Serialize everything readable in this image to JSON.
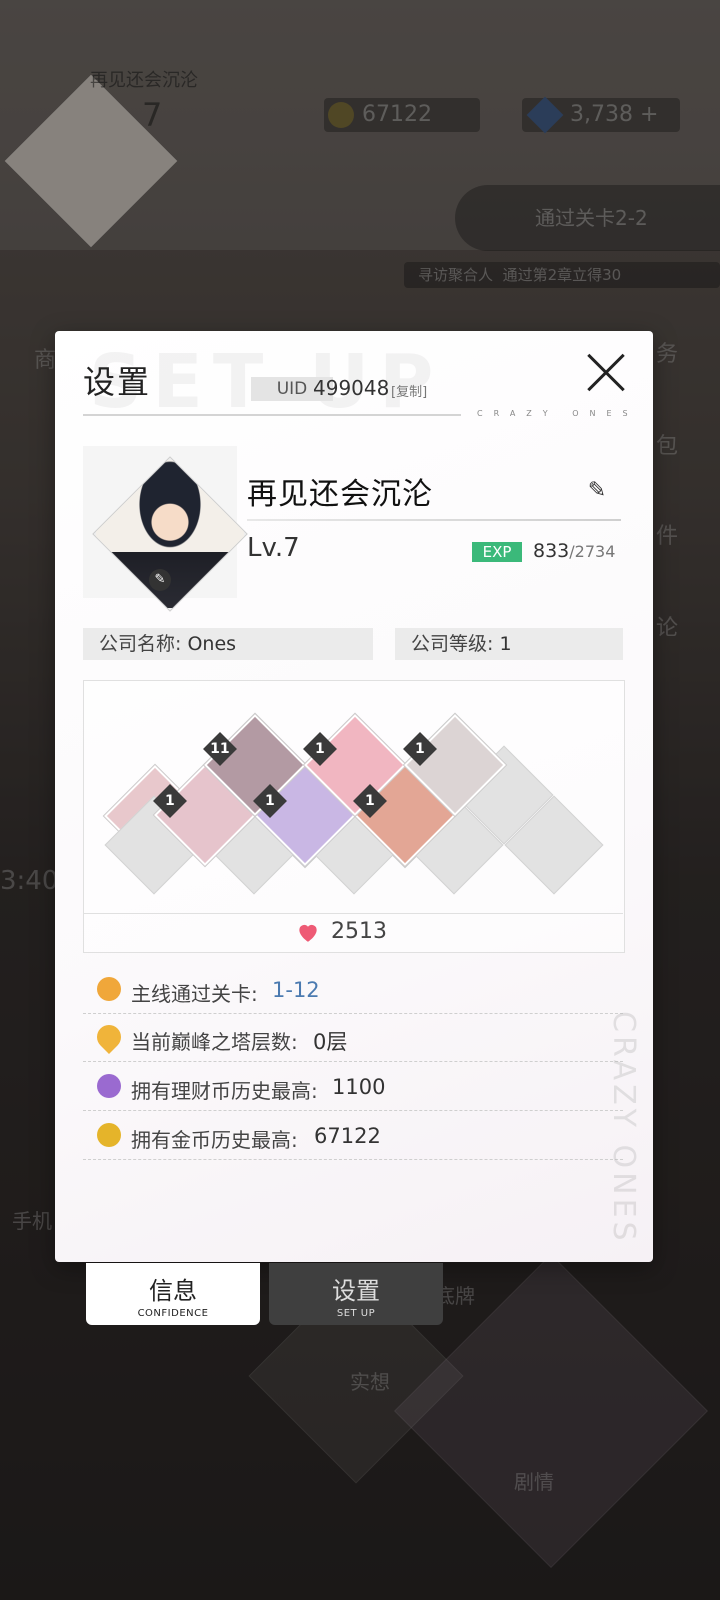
{
  "background": {
    "player_name": "再见还会沉沦",
    "level": "7",
    "gold": "67122",
    "gems": "3,738",
    "quest": "通过关卡2-2",
    "banner_left": "寻访聚合人",
    "banner_right": "通过第2章立得30",
    "side_labels": [
      "商",
      "务",
      "包",
      "件",
      "论"
    ],
    "bottom_labels": [
      "手机",
      "底牌",
      "实想",
      "剧情"
    ],
    "clock": "3:40"
  },
  "modal": {
    "ghost_title": "SET UP",
    "title": "设置",
    "uid_label": "UID",
    "uid_value": "499048",
    "uid_copy": "[复制]",
    "brand_small": "CRAZY ONES",
    "brand_vertical": "CRAZY ONES",
    "profile": {
      "name": "再见还会沉沦",
      "level": "Lv.7",
      "exp_label": "EXP",
      "exp_current": "833",
      "exp_max": "/2734"
    },
    "company": {
      "name_label": "公司名称:",
      "name_value": "Ones",
      "level_label": "公司等级:",
      "level_value": "1"
    },
    "characters": [
      {
        "badge": "1"
      },
      {
        "badge": "11"
      },
      {
        "badge": "1"
      },
      {
        "badge": "1"
      },
      {
        "badge": "1"
      },
      {
        "badge": "1"
      }
    ],
    "affection": "2513",
    "stats": [
      {
        "label": "主线通过关卡:",
        "value": "1-12",
        "icon": "film-reel-icon",
        "color": "#f0a73a"
      },
      {
        "label": "当前巅峰之塔层数:",
        "value": "0层",
        "icon": "location-pin-icon",
        "color": "#f0b43a"
      },
      {
        "label": "拥有理财币历史最高:",
        "value": "1100",
        "icon": "finance-coin-icon",
        "color": "#9a6ad0"
      },
      {
        "label": "拥有金币历史最高:",
        "value": "67122",
        "icon": "gold-coin-icon",
        "color": "#e5b42a"
      }
    ]
  },
  "tabs": [
    {
      "title": "信息",
      "subtitle": "CONFIDENCE",
      "active": true
    },
    {
      "title": "设置",
      "subtitle": "SET UP",
      "active": false
    }
  ]
}
